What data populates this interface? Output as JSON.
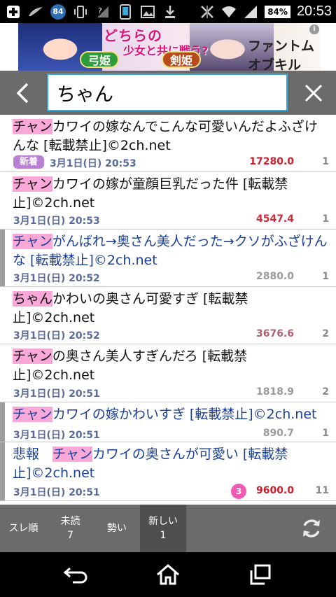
{
  "status_bar": {
    "notification_count": "84",
    "battery": "84%",
    "time": "20:53"
  },
  "ad": {
    "headline": "どちらの",
    "subline": "少女と共に戦う?",
    "left_label": "弓姫",
    "right_label": "剣姫",
    "logo": "ファントムオブキル"
  },
  "search": {
    "query": "ちゃん"
  },
  "threads": [
    {
      "highlight": "チャン",
      "rest": "カワイの嫁なんでこんな可愛いんだよふざけんな [転載禁止]©2ch.net",
      "new_badge": "新着",
      "date": "3月1日(日) 20:53",
      "score": "17280.0",
      "score_color": "#d01e2c",
      "count": "1",
      "read": false
    },
    {
      "highlight": "チャン",
      "rest": "カワイの嫁が童顔巨乳だった件 [転載禁止]©2ch.net",
      "new_badge": "",
      "date": "3月1日(日) 20:53",
      "score": "4547.4",
      "score_color": "#d0283a",
      "count": "1",
      "read": false
    },
    {
      "highlight": "チャン",
      "rest": "がんばれ→奥さん美人だった→クソがふざけんな [転載禁止]©2ch.net",
      "new_badge": "",
      "date": "3月1日(日) 20:52",
      "score": "2880.0",
      "score_color": "#9a9a9a",
      "count": "1",
      "read": true
    },
    {
      "highlight": "ちゃん",
      "rest": "かわいの奥さん可愛すぎ [転載禁止]©2ch.net",
      "new_badge": "",
      "date": "3月1日(日) 20:52",
      "score": "3676.6",
      "score_color": "#b06070",
      "count": "2",
      "read": false
    },
    {
      "highlight": "チャン",
      "rest": "の奥さん美人すぎんだろ [転載禁止]©2ch.net",
      "new_badge": "",
      "date": "3月1日(日) 20:51",
      "score": "1818.9",
      "score_color": "#9a9a9a",
      "count": "2",
      "read": false
    },
    {
      "highlight": "チャン",
      "rest": "カワイの嫁かわいすぎ [転載禁止]©2ch.net",
      "new_badge": "",
      "date": "3月1日(日) 20:51",
      "score": "890.7",
      "score_color": "#9a9a9a",
      "count": "1",
      "read": true
    },
    {
      "prefix": "悲報　",
      "highlight": "チャン",
      "rest": "カワイの奥さんが可愛い [転載禁止]©2ch.net",
      "new_badge": "",
      "date": "3月1日(日) 20:51",
      "badge": "3",
      "score": "9600.0",
      "score_color": "#d01e2c",
      "count": "11",
      "read": true
    }
  ],
  "tabs": [
    {
      "label": "スレ順",
      "count": ""
    },
    {
      "label": "未読",
      "count": "7"
    },
    {
      "label": "勢い",
      "count": ""
    },
    {
      "label": "新しい",
      "count": "1"
    }
  ],
  "colors": {
    "accent": "#39a9d8",
    "highlight": "#f9a8d7",
    "toolbar": "#6b6b6b"
  }
}
